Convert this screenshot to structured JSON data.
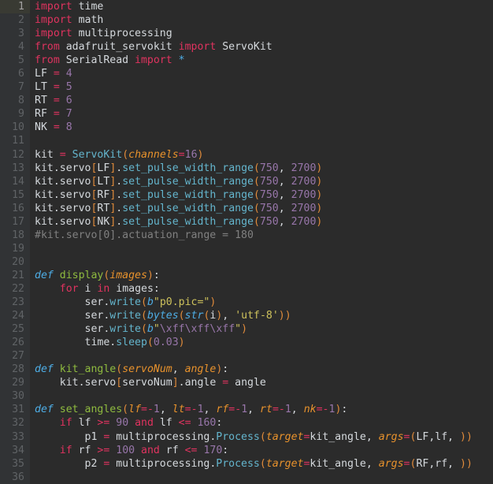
{
  "editor": {
    "name": "python-code-editor",
    "language": "python",
    "background_color": "#2b2b2b",
    "gutter_color": "#313335",
    "current_line": 1,
    "total_lines": 36,
    "colors": {
      "keyword": "#e0335f",
      "function": "#64b5cd",
      "function_def": "#8fbb3f",
      "number": "#9876aa",
      "string": "#cec25c",
      "comment": "#808080",
      "parameter": "#e8922c",
      "paren": "#e08b3b",
      "identifier": "#d5d9dd",
      "escape": "#9876aa",
      "prefix": "#4eade5"
    }
  },
  "line_numbers": [
    "1",
    "2",
    "3",
    "4",
    "5",
    "6",
    "7",
    "8",
    "9",
    "10",
    "11",
    "12",
    "13",
    "14",
    "15",
    "16",
    "17",
    "18",
    "19",
    "20",
    "21",
    "22",
    "23",
    "24",
    "25",
    "26",
    "27",
    "28",
    "29",
    "30",
    "31",
    "32",
    "33",
    "34",
    "35",
    "36"
  ],
  "code": {
    "lines": [
      "import time",
      "import math",
      "import multiprocessing",
      "from adafruit_servokit import ServoKit",
      "from SerialRead import *",
      "LF = 4",
      "LT = 5",
      "RT = 6",
      "RF = 7",
      "NK = 8",
      "",
      "kit = ServoKit(channels=16)",
      "kit.servo[LF].set_pulse_width_range(750, 2700)",
      "kit.servo[LT].set_pulse_width_range(750, 2700)",
      "kit.servo[RF].set_pulse_width_range(750, 2700)",
      "kit.servo[RT].set_pulse_width_range(750, 2700)",
      "kit.servo[NK].set_pulse_width_range(750, 2700)",
      "#kit.servo[0].actuation_range = 180",
      "",
      "",
      "def display(images):",
      "    for i in images:",
      "        ser.write(b\"p0.pic=\")",
      "        ser.write(bytes(str(i), 'utf-8'))",
      "        ser.write(b\"\\xff\\xff\\xff\")",
      "        time.sleep(0.03)",
      "",
      "def kit_angle(servoNum, angle):",
      "    kit.servo[servoNum].angle = angle",
      "",
      "def set_angles(lf=-1, lt=-1, rf=-1, rt=-1, nk=-1):",
      "    if lf >= 90 and lf <= 160:",
      "        p1 = multiprocessing.Process(target=kit_angle, args=(LF,lf, ))",
      "    if rf >= 100 and rf <= 170:",
      "        p2 = multiprocessing.Process(target=kit_angle, args=(RF,rf, ))",
      ""
    ],
    "tokens": [
      [
        [
          "import ",
          "kw2"
        ],
        [
          "time",
          "txt"
        ]
      ],
      [
        [
          "import ",
          "kw2"
        ],
        [
          "math",
          "txt"
        ]
      ],
      [
        [
          "import ",
          "kw2"
        ],
        [
          "multiprocessing",
          "txt"
        ]
      ],
      [
        [
          "from ",
          "kw2"
        ],
        [
          "adafruit_servokit ",
          "txt"
        ],
        [
          "import ",
          "kw2"
        ],
        [
          "ServoKit",
          "txt"
        ]
      ],
      [
        [
          "from ",
          "kw2"
        ],
        [
          "SerialRead ",
          "txt"
        ],
        [
          "import ",
          "kw2"
        ],
        [
          "*",
          "kwi"
        ]
      ],
      [
        [
          "LF ",
          "txt"
        ],
        [
          "= ",
          "op"
        ],
        [
          "4",
          "num"
        ]
      ],
      [
        [
          "LT ",
          "txt"
        ],
        [
          "= ",
          "op"
        ],
        [
          "5",
          "num"
        ]
      ],
      [
        [
          "RT ",
          "txt"
        ],
        [
          "= ",
          "op"
        ],
        [
          "6",
          "num"
        ]
      ],
      [
        [
          "RF ",
          "txt"
        ],
        [
          "= ",
          "op"
        ],
        [
          "7",
          "num"
        ]
      ],
      [
        [
          "NK ",
          "txt"
        ],
        [
          "= ",
          "op"
        ],
        [
          "8",
          "num"
        ]
      ],
      [],
      [
        [
          "kit ",
          "txt"
        ],
        [
          "= ",
          "op"
        ],
        [
          "ServoKit",
          "fn"
        ],
        [
          "(",
          "par"
        ],
        [
          "channels",
          "parm"
        ],
        [
          "=",
          "op"
        ],
        [
          "16",
          "num"
        ],
        [
          ")",
          "par"
        ]
      ],
      [
        [
          "kit.servo",
          "txt"
        ],
        [
          "[",
          "par"
        ],
        [
          "LF",
          "txt"
        ],
        [
          "]",
          "par"
        ],
        [
          ".",
          "txt"
        ],
        [
          "set_pulse_width_range",
          "fn"
        ],
        [
          "(",
          "par"
        ],
        [
          "750",
          "num"
        ],
        [
          ", ",
          "txt"
        ],
        [
          "2700",
          "num"
        ],
        [
          ")",
          "par"
        ]
      ],
      [
        [
          "kit.servo",
          "txt"
        ],
        [
          "[",
          "par"
        ],
        [
          "LT",
          "txt"
        ],
        [
          "]",
          "par"
        ],
        [
          ".",
          "txt"
        ],
        [
          "set_pulse_width_range",
          "fn"
        ],
        [
          "(",
          "par"
        ],
        [
          "750",
          "num"
        ],
        [
          ", ",
          "txt"
        ],
        [
          "2700",
          "num"
        ],
        [
          ")",
          "par"
        ]
      ],
      [
        [
          "kit.servo",
          "txt"
        ],
        [
          "[",
          "par"
        ],
        [
          "RF",
          "txt"
        ],
        [
          "]",
          "par"
        ],
        [
          ".",
          "txt"
        ],
        [
          "set_pulse_width_range",
          "fn"
        ],
        [
          "(",
          "par"
        ],
        [
          "750",
          "num"
        ],
        [
          ", ",
          "txt"
        ],
        [
          "2700",
          "num"
        ],
        [
          ")",
          "par"
        ]
      ],
      [
        [
          "kit.servo",
          "txt"
        ],
        [
          "[",
          "par"
        ],
        [
          "RT",
          "txt"
        ],
        [
          "]",
          "par"
        ],
        [
          ".",
          "txt"
        ],
        [
          "set_pulse_width_range",
          "fn"
        ],
        [
          "(",
          "par"
        ],
        [
          "750",
          "num"
        ],
        [
          ", ",
          "txt"
        ],
        [
          "2700",
          "num"
        ],
        [
          ")",
          "par"
        ]
      ],
      [
        [
          "kit.servo",
          "txt"
        ],
        [
          "[",
          "par"
        ],
        [
          "NK",
          "txt"
        ],
        [
          "]",
          "par"
        ],
        [
          ".",
          "txt"
        ],
        [
          "set_pulse_width_range",
          "fn"
        ],
        [
          "(",
          "par"
        ],
        [
          "750",
          "num"
        ],
        [
          ", ",
          "txt"
        ],
        [
          "2700",
          "num"
        ],
        [
          ")",
          "par"
        ]
      ],
      [
        [
          "#kit.servo[0].actuation_range = 180",
          "cmt"
        ]
      ],
      [],
      [],
      [
        [
          "def ",
          "kwi"
        ],
        [
          "display",
          "fndef"
        ],
        [
          "(",
          "par"
        ],
        [
          "images",
          "parm"
        ],
        [
          ")",
          "par"
        ],
        [
          ":",
          "txt"
        ]
      ],
      [
        [
          "    ",
          "txt"
        ],
        [
          "for ",
          "kw2"
        ],
        [
          "i ",
          "txt"
        ],
        [
          "in ",
          "kw2"
        ],
        [
          "images",
          "txt"
        ],
        [
          ":",
          "txt"
        ]
      ],
      [
        [
          "        ser",
          "txt"
        ],
        [
          ".",
          "txt"
        ],
        [
          "write",
          "fn"
        ],
        [
          "(",
          "par"
        ],
        [
          "b",
          "pre"
        ],
        [
          "\"p0.pic=\"",
          "str"
        ],
        [
          ")",
          "par"
        ]
      ],
      [
        [
          "        ser",
          "txt"
        ],
        [
          ".",
          "txt"
        ],
        [
          "write",
          "fn"
        ],
        [
          "(",
          "par"
        ],
        [
          "bytes",
          "kwi"
        ],
        [
          "(",
          "par"
        ],
        [
          "str",
          "kwi"
        ],
        [
          "(",
          "par"
        ],
        [
          "i",
          "txt"
        ],
        [
          ")",
          "par"
        ],
        [
          ", ",
          "txt"
        ],
        [
          "'utf-8'",
          "str"
        ],
        [
          ")",
          "par"
        ],
        [
          ")",
          "par"
        ]
      ],
      [
        [
          "        ser",
          "txt"
        ],
        [
          ".",
          "txt"
        ],
        [
          "write",
          "fn"
        ],
        [
          "(",
          "par"
        ],
        [
          "b",
          "pre"
        ],
        [
          "\"",
          "str"
        ],
        [
          "\\xff\\xff\\xff",
          "esc"
        ],
        [
          "\"",
          "str"
        ],
        [
          ")",
          "par"
        ]
      ],
      [
        [
          "        time",
          "txt"
        ],
        [
          ".",
          "txt"
        ],
        [
          "sleep",
          "fn"
        ],
        [
          "(",
          "par"
        ],
        [
          "0.03",
          "num"
        ],
        [
          ")",
          "par"
        ]
      ],
      [],
      [
        [
          "def ",
          "kwi"
        ],
        [
          "kit_angle",
          "fndef"
        ],
        [
          "(",
          "par"
        ],
        [
          "servoNum",
          "parm"
        ],
        [
          ", ",
          "txt"
        ],
        [
          "angle",
          "parm"
        ],
        [
          ")",
          "par"
        ],
        [
          ":",
          "txt"
        ]
      ],
      [
        [
          "    kit.servo",
          "txt"
        ],
        [
          "[",
          "par"
        ],
        [
          "servoNum",
          "txt"
        ],
        [
          "]",
          "par"
        ],
        [
          ".angle ",
          "txt"
        ],
        [
          "= ",
          "op"
        ],
        [
          "angle",
          "txt"
        ]
      ],
      [],
      [
        [
          "def ",
          "kwi"
        ],
        [
          "set_angles",
          "fndef"
        ],
        [
          "(",
          "par"
        ],
        [
          "lf",
          "parm"
        ],
        [
          "=",
          "op"
        ],
        [
          "-",
          "op"
        ],
        [
          "1",
          "num"
        ],
        [
          ", ",
          "txt"
        ],
        [
          "lt",
          "parm"
        ],
        [
          "=",
          "op"
        ],
        [
          "-",
          "op"
        ],
        [
          "1",
          "num"
        ],
        [
          ", ",
          "txt"
        ],
        [
          "rf",
          "parm"
        ],
        [
          "=",
          "op"
        ],
        [
          "-",
          "op"
        ],
        [
          "1",
          "num"
        ],
        [
          ", ",
          "txt"
        ],
        [
          "rt",
          "parm"
        ],
        [
          "=",
          "op"
        ],
        [
          "-",
          "op"
        ],
        [
          "1",
          "num"
        ],
        [
          ", ",
          "txt"
        ],
        [
          "nk",
          "parm"
        ],
        [
          "=",
          "op"
        ],
        [
          "-",
          "op"
        ],
        [
          "1",
          "num"
        ],
        [
          ")",
          "par"
        ],
        [
          ":",
          "txt"
        ]
      ],
      [
        [
          "    ",
          "txt"
        ],
        [
          "if ",
          "kw2"
        ],
        [
          "lf ",
          "txt"
        ],
        [
          ">= ",
          "op"
        ],
        [
          "90 ",
          "num"
        ],
        [
          "and ",
          "kw2"
        ],
        [
          "lf ",
          "txt"
        ],
        [
          "<= ",
          "op"
        ],
        [
          "160",
          "num"
        ],
        [
          ":",
          "txt"
        ]
      ],
      [
        [
          "        p1 ",
          "txt"
        ],
        [
          "= ",
          "op"
        ],
        [
          "multiprocessing",
          "txt"
        ],
        [
          ".",
          "txt"
        ],
        [
          "Process",
          "fn"
        ],
        [
          "(",
          "par"
        ],
        [
          "target",
          "parm"
        ],
        [
          "=",
          "op"
        ],
        [
          "kit_angle",
          "txt"
        ],
        [
          ", ",
          "txt"
        ],
        [
          "args",
          "parm"
        ],
        [
          "=",
          "op"
        ],
        [
          "(",
          "par"
        ],
        [
          "LF,lf, ",
          "txt"
        ],
        [
          ")",
          "par"
        ],
        [
          ")",
          "par"
        ]
      ],
      [
        [
          "    ",
          "txt"
        ],
        [
          "if ",
          "kw2"
        ],
        [
          "rf ",
          "txt"
        ],
        [
          ">= ",
          "op"
        ],
        [
          "100 ",
          "num"
        ],
        [
          "and ",
          "kw2"
        ],
        [
          "rf ",
          "txt"
        ],
        [
          "<= ",
          "op"
        ],
        [
          "170",
          "num"
        ],
        [
          ":",
          "txt"
        ]
      ],
      [
        [
          "        p2 ",
          "txt"
        ],
        [
          "= ",
          "op"
        ],
        [
          "multiprocessing",
          "txt"
        ],
        [
          ".",
          "txt"
        ],
        [
          "Process",
          "fn"
        ],
        [
          "(",
          "par"
        ],
        [
          "target",
          "parm"
        ],
        [
          "=",
          "op"
        ],
        [
          "kit_angle",
          "txt"
        ],
        [
          ", ",
          "txt"
        ],
        [
          "args",
          "parm"
        ],
        [
          "=",
          "op"
        ],
        [
          "(",
          "par"
        ],
        [
          "RF,rf, ",
          "txt"
        ],
        [
          ")",
          "par"
        ],
        [
          ")",
          "par"
        ]
      ],
      []
    ]
  },
  "indent_guides": [
    {
      "line_start": 22,
      "line_end": 26,
      "level": 1
    },
    {
      "line_start": 23,
      "line_end": 26,
      "level": 2
    },
    {
      "line_start": 29,
      "line_end": 29,
      "level": 1
    },
    {
      "line_start": 32,
      "line_end": 36,
      "level": 1
    },
    {
      "line_start": 33,
      "line_end": 33,
      "level": 2
    },
    {
      "line_start": 35,
      "line_end": 35,
      "level": 2
    }
  ]
}
